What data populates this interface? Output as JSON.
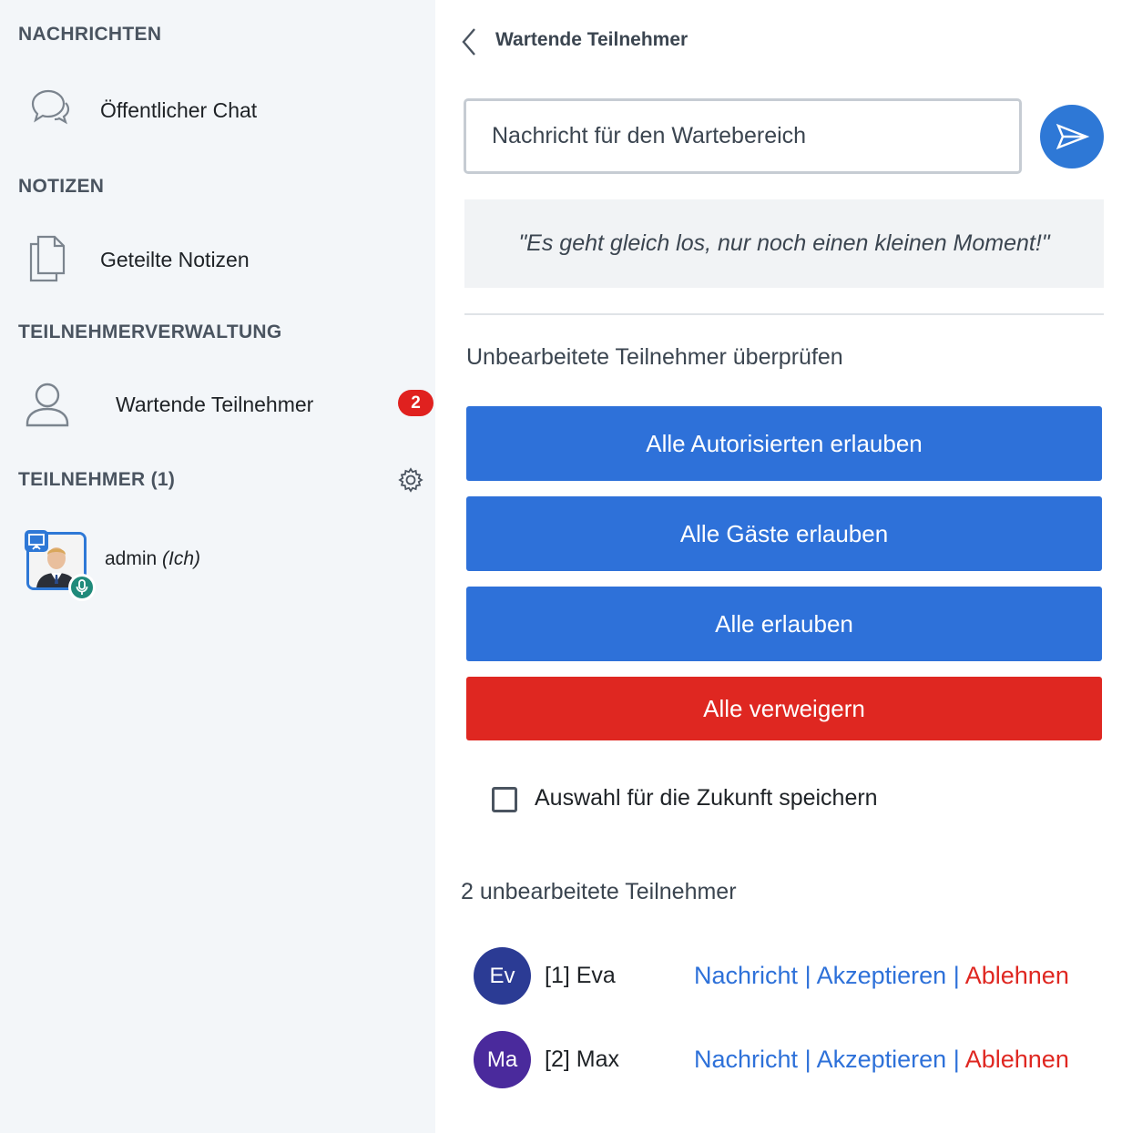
{
  "sidebar": {
    "sections": {
      "messages": "NACHRICHTEN",
      "notes": "NOTIZEN",
      "participant_management": "TEILNEHMERVERWALTUNG",
      "participants": "TEILNEHMER (1)"
    },
    "items": {
      "public_chat": {
        "label": "Öffentlicher Chat",
        "icon": "chat-bubbles-icon"
      },
      "shared_notes": {
        "label": "Geteilte Notizen",
        "icon": "documents-icon"
      },
      "waiting_users": {
        "label": "Wartende Teilnehmer",
        "icon": "user-icon",
        "badge": "2"
      }
    },
    "settings_icon": "gear-icon",
    "current_user": {
      "name": "admin",
      "suffix": "(Ich)",
      "presenter": true,
      "mic": true
    }
  },
  "panel": {
    "title": "Wartende Teilnehmer",
    "message_placeholder": "Nachricht für den Wartebereich",
    "guest_lobby_message": "\"Es geht gleich los, nur noch einen kleinen Moment!\"",
    "review_label": "Unbearbeitete Teilnehmer überprüfen",
    "buttons": {
      "allow_authenticated": "Alle Autorisierten erlauben",
      "allow_guests": "Alle Gäste erlauben",
      "allow_all": "Alle erlauben",
      "deny_all": "Alle verweigern"
    },
    "remember_choice": {
      "label": "Auswahl für die Zukunft speichern",
      "checked": false
    },
    "pending_count_label": "2 unbearbeitete Teilnehmer",
    "pending_users": [
      {
        "initials": "Ev",
        "name": "[1] Eva",
        "color": "#2b3b94"
      },
      {
        "initials": "Ma",
        "name": "[2] Max",
        "color": "#4a2a9c"
      }
    ],
    "row_actions": {
      "message": "Nachricht",
      "accept": "Akzeptieren",
      "reject": "Ablehnen",
      "separator": "|"
    }
  },
  "colors": {
    "primary": "#2e71d9",
    "danger": "#df2721",
    "sidebar_bg": "#f3f6f9"
  }
}
